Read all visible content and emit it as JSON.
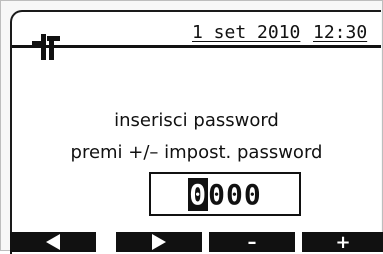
{
  "header": {
    "icon": "tool-icon",
    "date": "1 set 2010",
    "time": "12:30"
  },
  "prompt": {
    "line1": "inserisci password",
    "line2": "premi +/– impost. password"
  },
  "password": {
    "active_digit": "0",
    "rest_digits": "000"
  },
  "softkeys": {
    "left": "left-arrow-icon",
    "right": "right-arrow-icon",
    "minus": "–",
    "plus": "+"
  }
}
